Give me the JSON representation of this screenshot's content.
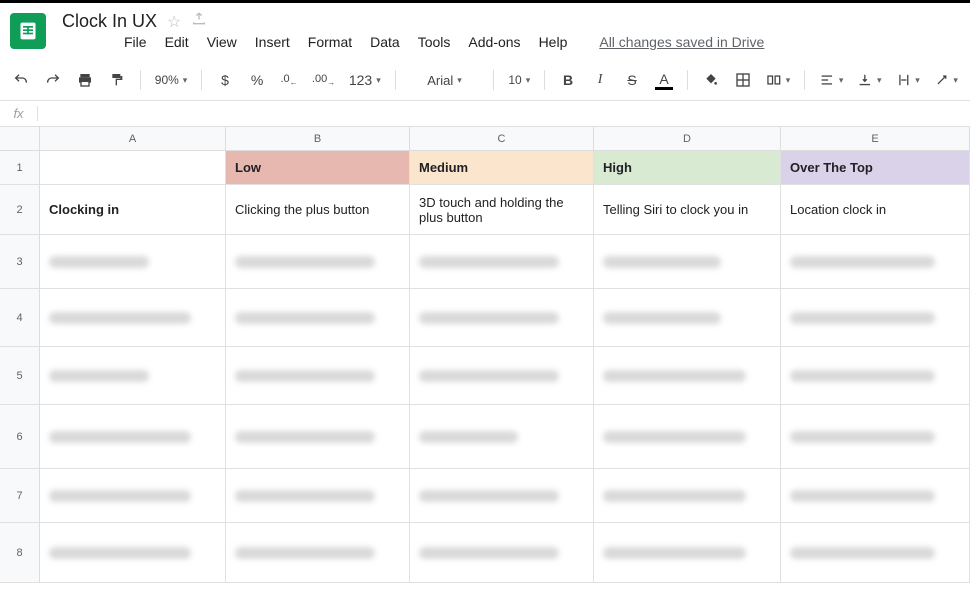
{
  "doc": {
    "title": "Clock In UX",
    "saved": "All changes saved in Drive"
  },
  "menu": {
    "file": "File",
    "edit": "Edit",
    "view": "View",
    "insert": "Insert",
    "format": "Format",
    "data": "Data",
    "tools": "Tools",
    "addons": "Add-ons",
    "help": "Help"
  },
  "toolbar": {
    "zoom": "90%",
    "currency": "$",
    "percent": "%",
    "dec_dec": ".0",
    "inc_dec": ".00",
    "numfmt": "123",
    "font": "Arial",
    "fontsize": "10",
    "bold": "B",
    "italic": "I",
    "fx": "fx"
  },
  "cols": {
    "A": "A",
    "B": "B",
    "C": "C",
    "D": "D",
    "E": "E"
  },
  "rows": {
    "r1": "1",
    "r2": "2",
    "r3": "3",
    "r4": "4",
    "r5": "5",
    "r6": "6",
    "r7": "7",
    "r8": "8"
  },
  "headers": {
    "low": "Low",
    "medium": "Medium",
    "high": "High",
    "top": "Over The Top"
  },
  "row2": {
    "A": "Clocking in",
    "B": "Clicking the plus button",
    "C": "3D touch and holding the plus button",
    "D": "Telling Siri to clock you in",
    "E": "Location clock in"
  }
}
